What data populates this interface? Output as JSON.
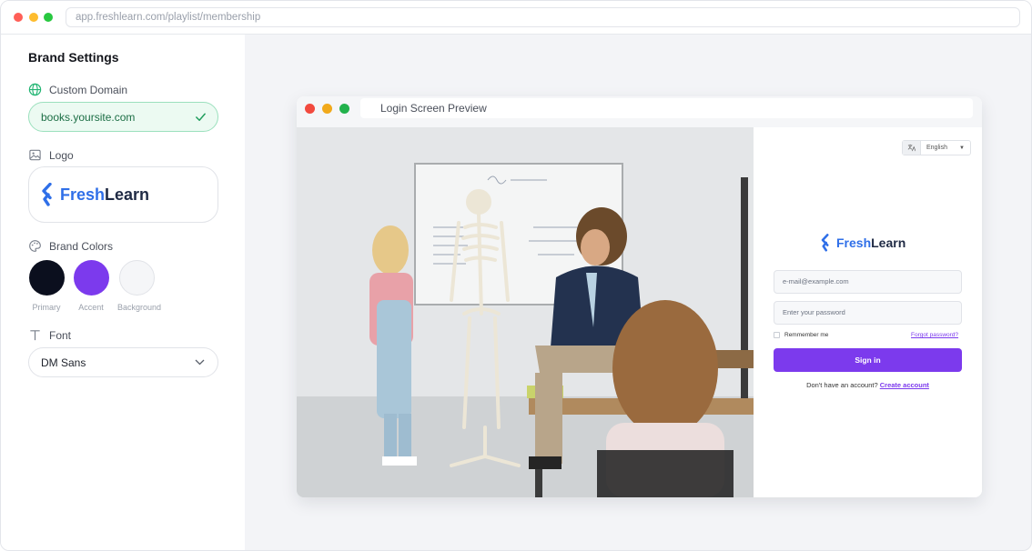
{
  "browser": {
    "url": "app.freshlearn.com/playlist/membership"
  },
  "sidebar": {
    "title": "Brand Settings",
    "custom_domain": {
      "label": "Custom Domain",
      "value": "books.yoursite.com"
    },
    "logo": {
      "label": "Logo",
      "brand_part1": "Fresh",
      "brand_part2": "Learn"
    },
    "brand_colors": {
      "label": "Brand Colors",
      "swatches": [
        {
          "name": "Primary",
          "color": "#0b0f1e"
        },
        {
          "name": "Accent",
          "color": "#7c3aed"
        },
        {
          "name": "Background",
          "color": "#f5f6f8"
        }
      ]
    },
    "font": {
      "label": "Font",
      "value": "DM Sans"
    }
  },
  "preview": {
    "title": "Login Screen Preview",
    "login": {
      "language": "English",
      "brand_part1": "Fresh",
      "brand_part2": "Learn",
      "email_placeholder": "e-mail@example.com",
      "password_placeholder": "Enter your password",
      "remember": "Remmember me",
      "forgot": "Forgot password?",
      "signin": "Sign in",
      "no_account": "Don't have an account?",
      "create_account": "Create account"
    }
  }
}
